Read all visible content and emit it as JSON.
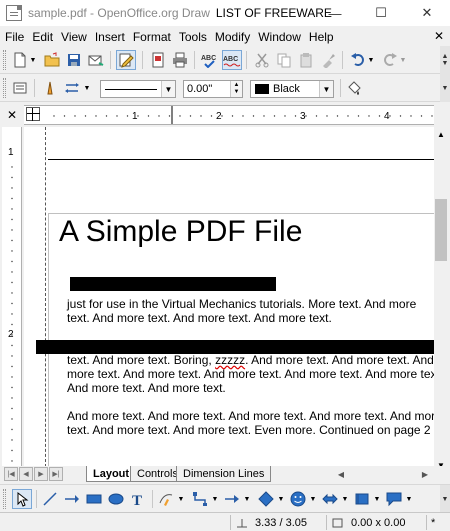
{
  "window": {
    "title": "sample.pdf - OpenOffice.org Draw",
    "title_extra": "LIST OF FREEWARE",
    "minimize_glyph": "—",
    "maximize_glyph": "☐",
    "close_glyph": "✕"
  },
  "menu": {
    "items": [
      "File",
      "Edit",
      "View",
      "Insert",
      "Format",
      "Tools",
      "Modify",
      "Window",
      "Help"
    ],
    "close_glyph": "✕"
  },
  "toolbar_format": {
    "line_width": "0.00\"",
    "color_name": "Black",
    "color_swatch": "#000000"
  },
  "ruler": {
    "h_numbers": [
      "1",
      "2",
      "3",
      "4"
    ],
    "v_numbers": [
      "1",
      "2"
    ]
  },
  "document": {
    "title": "A Simple PDF File",
    "para1": [
      "just for use in the Virtual Mechanics tutorials. More text. And more",
      "text. And more text. And more text. And more text."
    ],
    "para2_line1_pre": "text. And more text. Boring, ",
    "para2_line1_sq": "zzzzz",
    "para2_line1_post": ". And more text. And more text. And",
    "para2_rest": [
      "more text. And more text. And more text. And more text. And more tex",
      "And more text. And more text."
    ],
    "para3": [
      "And more text. And more text. And more text. And more text. And more",
      "text. And more text. And more text. Even more. Continued on page 2 ..."
    ]
  },
  "layer_tabs": [
    "Layout",
    "Controls",
    "Dimension Lines"
  ],
  "status": {
    "position": "3.33 / 3.05",
    "size": "0.00 x 0.00",
    "modified": "*"
  }
}
